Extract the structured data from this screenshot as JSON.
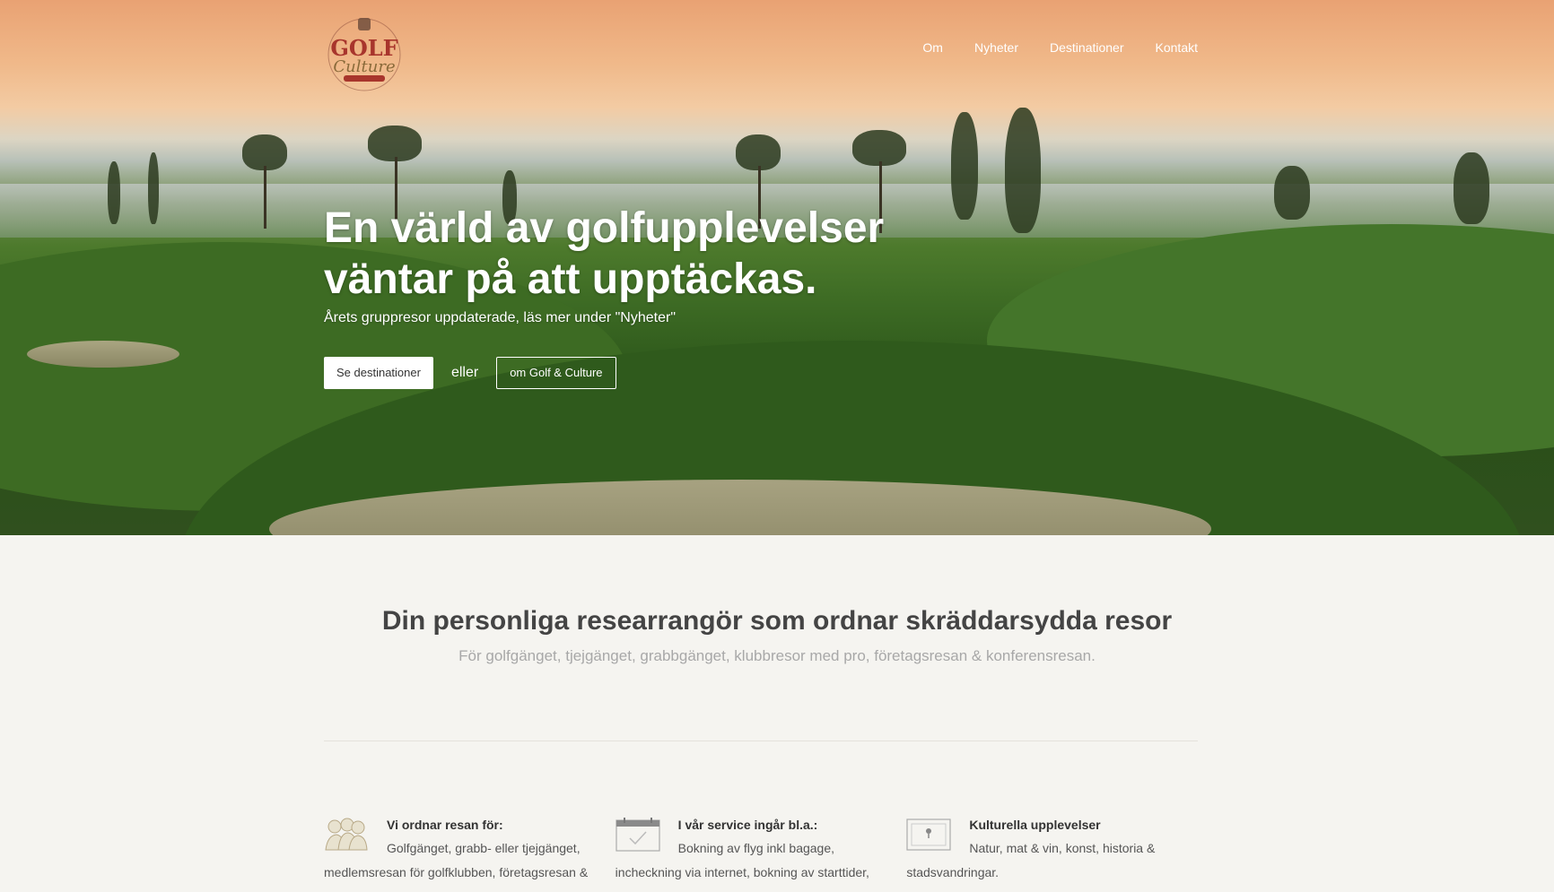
{
  "brand": {
    "logo_alt": "Golf & Culture"
  },
  "nav": {
    "items": [
      "Om",
      "Nyheter",
      "Destinationer",
      "Kontakt"
    ]
  },
  "hero": {
    "title_line1": "En värld av golfupplevelser",
    "title_line2": "väntar på att upptäckas.",
    "subtitle": "Årets gruppresor uppdaterade, läs mer under \"Nyheter\"",
    "primary_button": "Se destinationer",
    "separator": "eller",
    "secondary_button": "om Golf & Culture"
  },
  "intro": {
    "title": "Din personliga researrangör som ordnar skräddarsydda resor",
    "subtitle": "För golfgänget, tjejgänget, grabbgänget, klubbresor med pro, företagsresan & konferensresan."
  },
  "features": [
    {
      "icon": "group-people-icon",
      "heading": "Vi ordnar resan för:",
      "body": "Golfgänget, grabb- eller tjejgänget, medlemsresan för golfklubben, företagsresan &"
    },
    {
      "icon": "calendar-check-icon",
      "heading": "I vår service ingår bl.a.:",
      "body": "Bokning av flyg inkl bagage, incheckning via internet, bokning av starttider,"
    },
    {
      "icon": "map-icon",
      "heading": "Kulturella upplevelser",
      "body": "Natur, mat & vin, konst, historia & stadsvandringar."
    }
  ],
  "colors": {
    "background": "#f5f4f0",
    "hero_sky": "#e9a273",
    "hero_grass": "#3f6d25",
    "heading": "#444444",
    "muted": "#a8a8a8"
  }
}
